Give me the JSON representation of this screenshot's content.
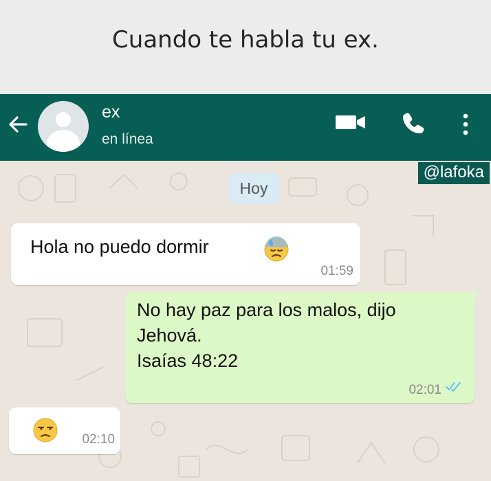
{
  "caption": "Cuando te habla tu ex.",
  "header": {
    "contact_name": "ex",
    "contact_status": "en línea",
    "color": "#075e54"
  },
  "watermark": "@lafoka",
  "chat": {
    "date_label": "Hoy",
    "messages": [
      {
        "direction": "incoming",
        "text": "Hola no puedo dormir",
        "emoji": "sad-sweat-face",
        "time": "01:59"
      },
      {
        "direction": "outgoing",
        "lines": [
          "No hay paz para los malos, dijo",
          "Jehová.",
          "Isaías 48:22"
        ],
        "time": "02:01",
        "status": "read"
      },
      {
        "direction": "incoming",
        "emoji": "unamused-face",
        "time": "02:10"
      }
    ]
  },
  "colors": {
    "outgoing_bubble": "#dcf8c6",
    "incoming_bubble": "#ffffff",
    "chat_background": "#ece5dd",
    "read_ticks": "#4fc3f7"
  },
  "icons": [
    "back-arrow-icon",
    "video-call-icon",
    "phone-icon",
    "more-options-icon",
    "double-check-icon"
  ]
}
